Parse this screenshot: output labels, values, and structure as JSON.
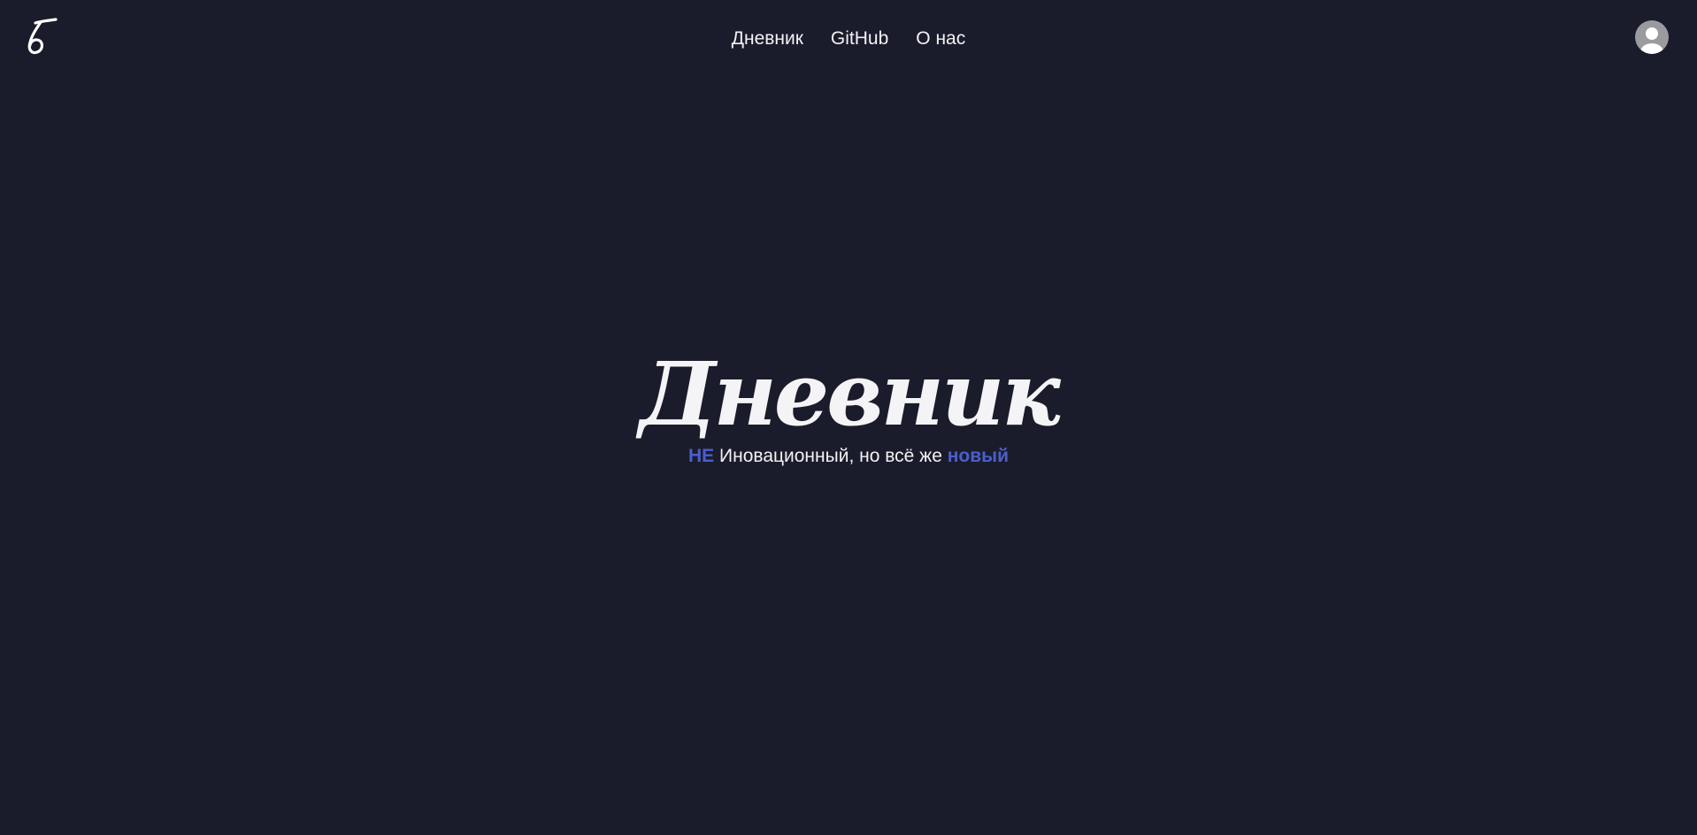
{
  "header": {
    "logo_icon": "script-b-logo-icon",
    "nav": [
      {
        "label": "Дневник"
      },
      {
        "label": "GitHub"
      },
      {
        "label": "О нас"
      }
    ],
    "avatar_icon": "user-avatar-icon"
  },
  "hero": {
    "title": "Дневник",
    "subtitle": {
      "prefix_accent": "НЕ",
      "middle": " Иновационный, но всё же ",
      "suffix_accent": "новый"
    }
  },
  "colors": {
    "background": "#1b1c2b",
    "text": "#f2f2f4",
    "accent": "#4b5fcc",
    "avatar": "#9a9a9f"
  }
}
